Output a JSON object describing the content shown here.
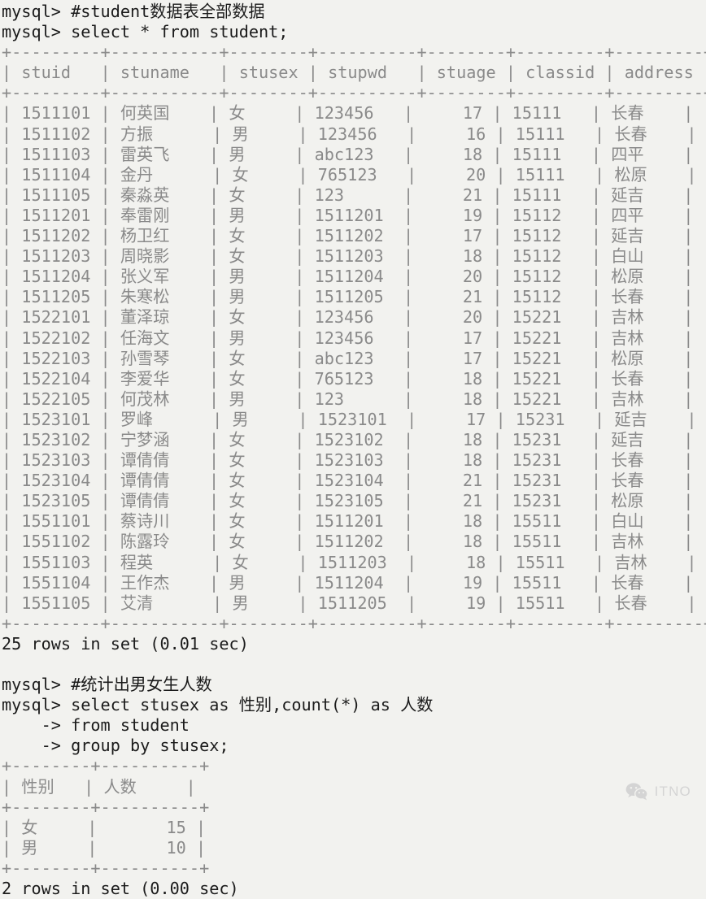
{
  "terminal": {
    "prompt": "mysql> ",
    "continuation": "    -> ",
    "block1": {
      "comment_line": "mysql> #student数据表全部数据",
      "query_line": "mysql> select * from student;",
      "result_footer": "25 rows in set (0.01 sec)",
      "columns": [
        {
          "name": "stuid",
          "width": 9,
          "align": "right"
        },
        {
          "name": "stuname",
          "width": 11,
          "align": "left"
        },
        {
          "name": "stusex",
          "width": 8,
          "align": "left"
        },
        {
          "name": "stupwd",
          "width": 10,
          "align": "left"
        },
        {
          "name": "stuage",
          "width": 8,
          "align": "right"
        },
        {
          "name": "classid",
          "width": 9,
          "align": "left"
        },
        {
          "name": "address",
          "width": 9,
          "align": "left"
        }
      ],
      "rows": [
        [
          "1511101",
          "何英国",
          "女",
          "123456",
          "17",
          "15111",
          "长春"
        ],
        [
          "1511102",
          "方振",
          "男",
          "123456",
          "16",
          "15111",
          "长春"
        ],
        [
          "1511103",
          "雷英飞",
          "男",
          "abc123",
          "18",
          "15111",
          "四平"
        ],
        [
          "1511104",
          "金丹",
          "女",
          "765123",
          "20",
          "15111",
          "松原"
        ],
        [
          "1511105",
          "秦淼英",
          "女",
          "123",
          "21",
          "15111",
          "延吉"
        ],
        [
          "1511201",
          "奉雷刚",
          "男",
          "1511201",
          "19",
          "15112",
          "四平"
        ],
        [
          "1511202",
          "杨卫红",
          "女",
          "1511202",
          "17",
          "15112",
          "延吉"
        ],
        [
          "1511203",
          "周晓影",
          "女",
          "1511203",
          "18",
          "15112",
          "白山"
        ],
        [
          "1511204",
          "张义军",
          "男",
          "1511204",
          "20",
          "15112",
          "松原"
        ],
        [
          "1511205",
          "朱寒松",
          "男",
          "1511205",
          "21",
          "15112",
          "长春"
        ],
        [
          "1522101",
          "董泽琼",
          "女",
          "123456",
          "20",
          "15221",
          "吉林"
        ],
        [
          "1522102",
          "任海文",
          "男",
          "123456",
          "17",
          "15221",
          "吉林"
        ],
        [
          "1522103",
          "孙雪琴",
          "女",
          "abc123",
          "17",
          "15221",
          "松原"
        ],
        [
          "1522104",
          "李爱华",
          "女",
          "765123",
          "18",
          "15221",
          "长春"
        ],
        [
          "1522105",
          "何茂林",
          "男",
          "123",
          "18",
          "15221",
          "吉林"
        ],
        [
          "1523101",
          "罗峰",
          "男",
          "1523101",
          "17",
          "15231",
          "延吉"
        ],
        [
          "1523102",
          "宁梦涵",
          "女",
          "1523102",
          "18",
          "15231",
          "延吉"
        ],
        [
          "1523103",
          "谭倩倩",
          "女",
          "1523103",
          "18",
          "15231",
          "长春"
        ],
        [
          "1523104",
          "谭倩倩",
          "女",
          "1523104",
          "21",
          "15231",
          "长春"
        ],
        [
          "1523105",
          "谭倩倩",
          "女",
          "1523105",
          "21",
          "15231",
          "松原"
        ],
        [
          "1551101",
          "蔡诗川",
          "女",
          "1511201",
          "18",
          "15511",
          "白山"
        ],
        [
          "1551102",
          "陈露玲",
          "女",
          "1511202",
          "18",
          "15511",
          "吉林"
        ],
        [
          "1551103",
          "程英",
          "女",
          "1511203",
          "18",
          "15511",
          "吉林"
        ],
        [
          "1551104",
          "王作杰",
          "男",
          "1511204",
          "19",
          "15511",
          "长春"
        ],
        [
          "1551105",
          "艾清",
          "男",
          "1511205",
          "19",
          "15511",
          "长春"
        ]
      ]
    },
    "block2": {
      "comment_line": "mysql> #统计出男女生人数",
      "query_line_1": "mysql> select stusex as 性别,count(*) as 人数",
      "query_line_2": "    -> from student",
      "query_line_3": "    -> group by stusex;",
      "result_footer": "2 rows in set (0.00 sec)",
      "columns": [
        {
          "name": "性别",
          "width": 8,
          "align": "left"
        },
        {
          "name": "人数",
          "width": 10,
          "align": "right"
        }
      ],
      "rows": [
        [
          "女",
          "15"
        ],
        [
          "男",
          "10"
        ]
      ]
    }
  },
  "watermark": {
    "label": "ITNO",
    "icon": "wechat-icon"
  },
  "colors": {
    "background": "#f2f2ef",
    "text": "#1b1b1b",
    "rule": "#8a8a8a",
    "watermark": "#9a9aa0"
  }
}
